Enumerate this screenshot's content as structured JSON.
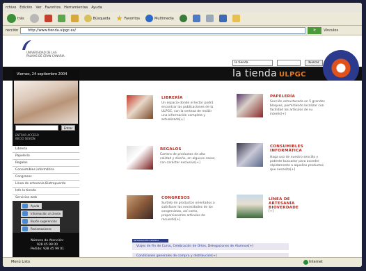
{
  "browser": {
    "menu": [
      "rchivo",
      "Edición",
      "Ver",
      "Favoritos",
      "Herramientas",
      "Ayuda"
    ],
    "toolbar": {
      "back_label": "trás",
      "search_label": "Búsqueda",
      "favorites_label": "Favoritos",
      "multimedia_label": "Multimedia"
    },
    "address_label": "rección",
    "address_value": "http://www.tienda.ulpgc.es/",
    "go_label": "Ir",
    "links_label": "Vínculos"
  },
  "site": {
    "university_name": "UNIVERSIDAD DE LAS PALMAS DE GRAN CANARIA",
    "search_select_value": "la tienda",
    "search_button": "buscar",
    "title": "la tienda",
    "title_suffix": "ULPGC"
  },
  "sidebar": {
    "date": "Viernes, 24 septiembre 2004",
    "search_button": "Entrar",
    "search_label": "ENTRAR ACCESO\nINICIO SESIÓN",
    "menu": [
      "Librería",
      "Papelería",
      "Regalos",
      "Consumibles informática",
      "Congresos",
      "Línea de artesanía Biotropuerde",
      "Info la tienda",
      "Servicios web"
    ],
    "subitems": [
      "Ayuda",
      "Información al cliente",
      "Buzón sugerencias",
      "Reclamaciones"
    ],
    "contact": "Número de Atención:\n928 45 99 00\nPedido: 928 45 99 01"
  },
  "categories": [
    {
      "title": "LIBRERÍA",
      "desc": "Un espacio donde el lector podrá encontrar las publicaciones de la ULPGC, con la certeza de recibir una información completa y actualizada[+]"
    },
    {
      "title": "PAPELERÍA",
      "desc": "Sección estructurada en 5 grandes bloques, permitiendo localizar con facilidad los artículos de su interés[+]"
    },
    {
      "title": "REGALOS",
      "desc": "Cartera de productos de alta calidad y diseño, en algunos casos, con carácter exclusivo[+]"
    },
    {
      "title": "CONSUMIBLES INFORMÁTICA",
      "desc": "Haga uso de nuestro sencillo y potente buscador para acceder rápidamente a aquellos productos que necesita[+]"
    },
    {
      "title": "CONGRESOS",
      "desc": "Surtido de productos orientados a satisfacer las necesidades de los congresistas, así como, proporcionarles artículos de recuerdo[+]"
    },
    {
      "title": "LÍNEA DE ARTESANÍA BIOVERDADE",
      "desc": "[+]"
    }
  ],
  "info": {
    "header": "INFORMACIÓN GENERAL",
    "lines": [
      "Viajes de Fin de Curso, Celebración de Ortes, Delegaciones de Alumnos[+]",
      "Condiciones generales de compra y distribución[+]"
    ]
  },
  "status": {
    "text": "Menú Listo",
    "zone": "Internet"
  },
  "colors": {
    "accent_red": "#b3271c",
    "accent_orange": "#e87a1c",
    "link_blue": "#223a9a"
  }
}
